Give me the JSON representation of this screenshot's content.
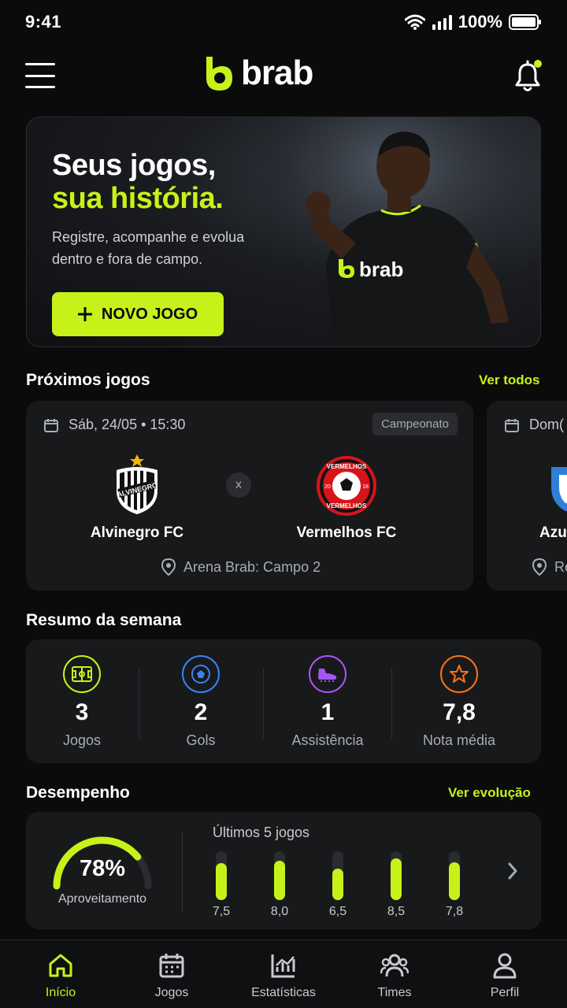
{
  "status_bar": {
    "time": "9:41",
    "battery": "100%"
  },
  "header": {
    "brand": "brab",
    "accent_color": "#c6f21a"
  },
  "hero": {
    "title_line1": "Seus jogos,",
    "title_line2": "sua história.",
    "subtitle": "Registre, acompanhe e evolua dentro e fora de campo.",
    "button_label": "NOVO JOGO",
    "shirt_logo": "brab"
  },
  "upcoming": {
    "title": "Próximos jogos",
    "link": "Ver todos",
    "match": {
      "date": "Sáb, 24/05 • 15:30",
      "tag": "Campeonato",
      "home": "Alvinegro FC",
      "home_crest_text": "ALVINEGRO",
      "vs": "x",
      "away": "Vermelhos FC",
      "away_crest_text_top": "VERMELHOS",
      "away_crest_text_bottom": "VERMELHOS",
      "away_crest_year_left": "20",
      "away_crest_year_right": "18",
      "venue": "Arena Brab: Campo 2"
    },
    "next_match_preview": {
      "date": "Dom(",
      "team": "Azu",
      "venue": "Re"
    }
  },
  "summary": {
    "title": "Resumo da semana",
    "stats": [
      {
        "icon": "field-icon",
        "value": "3",
        "label": "Jogos",
        "color": "#c6f21a"
      },
      {
        "icon": "ball-icon",
        "value": "2",
        "label": "Gols",
        "color": "#3b82f6"
      },
      {
        "icon": "boot-icon",
        "value": "1",
        "label": "Assistência",
        "color": "#a855f7"
      },
      {
        "icon": "star-icon",
        "value": "7,8",
        "label": "Nota média",
        "color": "#f97316"
      }
    ]
  },
  "performance": {
    "title": "Desempenho",
    "link": "Ver evolução",
    "gauge_value": "78%",
    "gauge_fraction": 0.78,
    "gauge_label": "Aproveitamento",
    "bars_title": "Últimos 5 jogos",
    "bars": [
      {
        "label": "7,5",
        "value": 7.5
      },
      {
        "label": "8,0",
        "value": 8.0
      },
      {
        "label": "6,5",
        "value": 6.5
      },
      {
        "label": "8,5",
        "value": 8.5
      },
      {
        "label": "7,8",
        "value": 7.8
      }
    ]
  },
  "nav": {
    "items": [
      {
        "label": "Início",
        "icon": "home-icon",
        "active": true
      },
      {
        "label": "Jogos",
        "icon": "calendar-icon",
        "active": false
      },
      {
        "label": "Estatísticas",
        "icon": "chart-icon",
        "active": false
      },
      {
        "label": "Times",
        "icon": "team-icon",
        "active": false
      },
      {
        "label": "Perfil",
        "icon": "profile-icon",
        "active": false
      }
    ]
  }
}
